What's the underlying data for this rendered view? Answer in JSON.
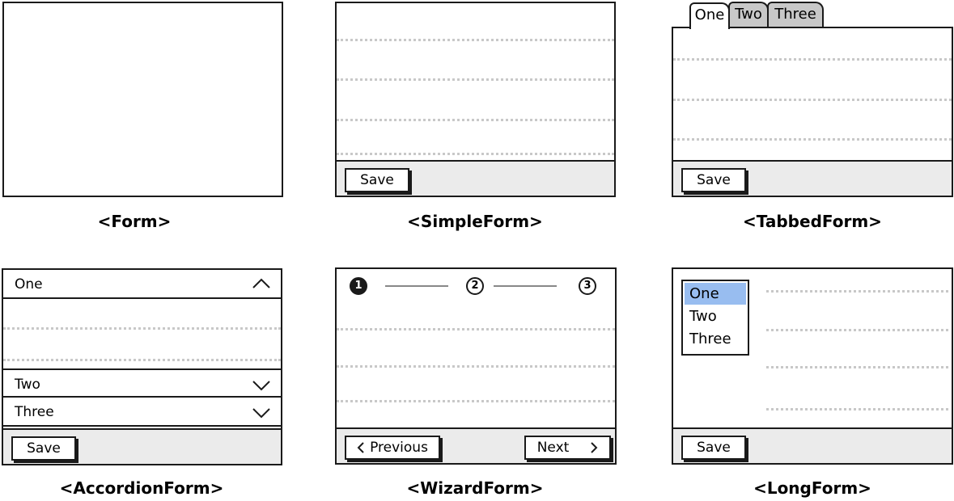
{
  "forms": {
    "form": {
      "caption": "<Form>"
    },
    "simple": {
      "caption": "<SimpleForm>",
      "save": "Save"
    },
    "tabbed": {
      "caption": "<TabbedForm>",
      "save": "Save",
      "tabs": [
        "One",
        "Two",
        "Three"
      ]
    },
    "accordion": {
      "caption": "<AccordionForm>",
      "save": "Save",
      "sections": [
        "One",
        "Two",
        "Three"
      ]
    },
    "wizard": {
      "caption": "<WizardForm>",
      "steps": [
        "1",
        "2",
        "3"
      ],
      "previous": "Previous",
      "next": "Next"
    },
    "long": {
      "caption": "<LongForm>",
      "save": "Save",
      "menu": [
        "One",
        "Two",
        "Three"
      ]
    }
  },
  "colors": {
    "footer": "#ebebeb",
    "tab_inactive": "#c8c8c8",
    "selected": "#98bdf0",
    "dots": "#c8c8c8"
  },
  "icons": [
    "chevron-up-icon",
    "chevron-down-icon",
    "chevron-left-icon",
    "chevron-right-icon"
  ]
}
